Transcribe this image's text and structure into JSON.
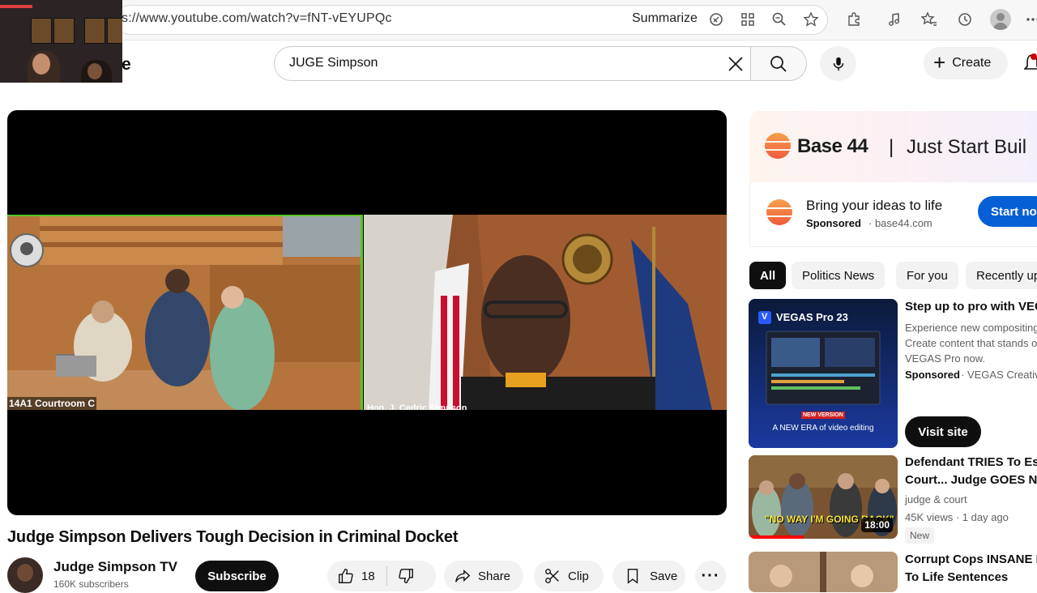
{
  "browser": {
    "url": "s://www.youtube.com/watch?v=fNT-vEYUPQc",
    "summarize_label": "Summarize"
  },
  "header": {
    "logo_fragment": "e",
    "search_value": "JUGE Simpson",
    "create_label": "Create"
  },
  "player": {
    "left_caption": "14A1 Courtroom C",
    "right_caption": "Hon. J. Cedric Simpson"
  },
  "video": {
    "title": "Judge Simpson Delivers Tough Decision in Criminal Docket",
    "channel": "Judge Simpson TV",
    "subscribers": "160K subscribers",
    "subscribe_label": "Subscribe",
    "likes": "18",
    "share_label": "Share",
    "clip_label": "Clip",
    "save_label": "Save",
    "more_label": "···"
  },
  "ad": {
    "brand": "Base 44",
    "divider": "|",
    "tagline": "Just Start Buil",
    "headline": "Bring your ideas to life",
    "sponsored": "Sponsored",
    "domain": "· base44.com",
    "cta": "Start now"
  },
  "chips": [
    "All",
    "Politics News",
    "For you",
    "Recently up"
  ],
  "recommendations": [
    {
      "title": "Step up to pro with VEGA",
      "desc": [
        "Experience new compositing",
        "Create content that stands o",
        "VEGAS Pro now."
      ],
      "sponsored": "Sponsored",
      "sponsor_name": "· VEGAS Creative",
      "cta": "Visit site",
      "thumb_brand": "VEGAS Pro 23",
      "thumb_badge": "NEW VERSION",
      "thumb_caption": "A NEW ERA of video editing"
    },
    {
      "title_line1": "Defendant TRIES To Esc",
      "title_line2": "Court... Judge GOES NU",
      "channel": "judge & court",
      "meta": "45K views · 1 day ago",
      "badge": "New",
      "duration": "18:00",
      "thumb_text": "\"NO WAY I'M GOING BACK\""
    },
    {
      "title_line1": "Corrupt Cops INSANE R",
      "title_line2": "To Life Sentences"
    }
  ],
  "colors": {
    "accent_blue": "#065fd4",
    "subscribe_black": "#0f0f0f",
    "feed_border_green": "#5cc42a"
  }
}
